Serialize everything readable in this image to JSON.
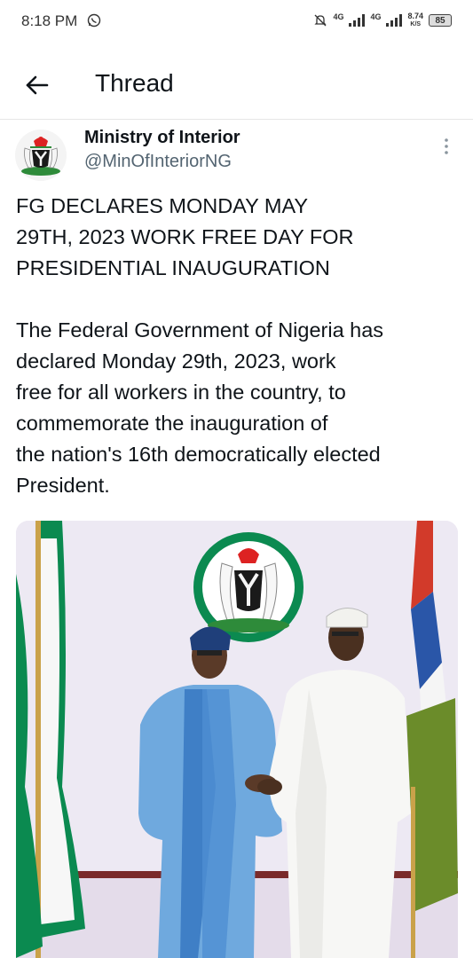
{
  "status_bar": {
    "time": "8:18 PM",
    "net1": "4G",
    "net2": "4G",
    "speed_value": "8.74",
    "speed_unit": "K/S",
    "battery": "85"
  },
  "header": {
    "title": "Thread"
  },
  "tweet": {
    "author_name": "Ministry of Interior",
    "author_handle": "@MinOfInteriorNG",
    "text": "FG DECLARES MONDAY MAY\n29TH, 2023 WORK FREE DAY FOR\nPRESIDENTIAL INAUGURATION\n\nThe Federal Government of Nigeria has\ndeclared Monday 29th, 2023, work\nfree for all workers in the country, to\ncommemorate the inauguration of\nthe nation's 16th democratically elected\nPresident."
  },
  "icons": {
    "back": "back-arrow-icon",
    "more": "more-vertical-icon",
    "whatsapp": "whatsapp-icon",
    "mute": "bell-off-icon"
  },
  "colors": {
    "text_primary": "#0f1419",
    "text_secondary": "#536471",
    "flag_green": "#0b8a50",
    "agbada_blue": "#6fa9de"
  }
}
